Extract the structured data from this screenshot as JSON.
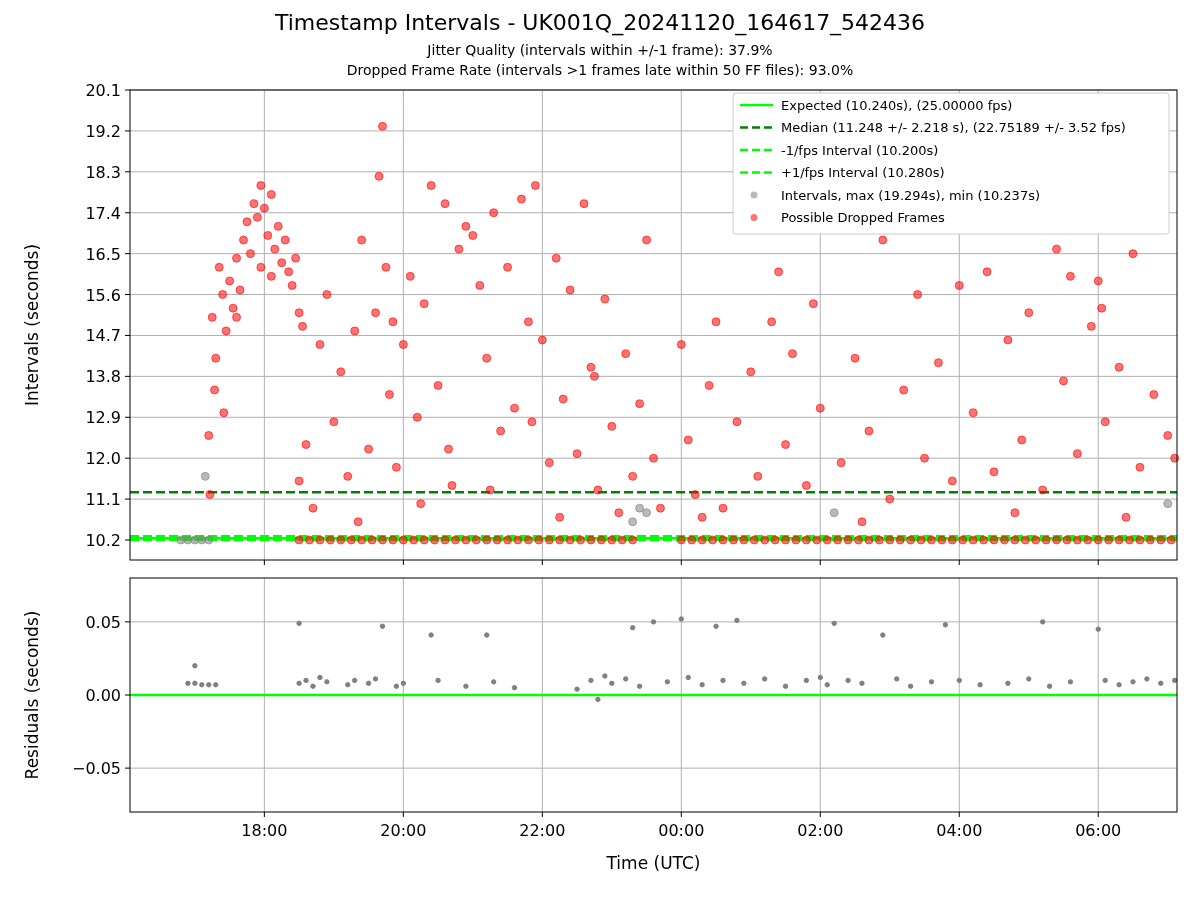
{
  "title": "Timestamp Intervals - UK001Q_20241120_164617_542436",
  "subtitles": [
    "Jitter Quality (intervals within +/-1 frame): 37.9%",
    "Dropped Frame Rate (intervals >1 frames late within 50 FF files): 93.0%"
  ],
  "interval_plot": {
    "chart_data": {
      "type": "scatter",
      "ylabel": "Intervals (seconds)",
      "grid": true,
      "legend": true,
      "xlim": [
        "2024-11-20T16:04",
        "2024-11-21T07:08"
      ],
      "ylim": [
        9.76,
        20.1
      ],
      "yticks": [
        {
          "value": 10.2,
          "label": "10.2"
        },
        {
          "value": 11.1,
          "label": "11.1"
        },
        {
          "value": 12.0,
          "label": "12.0"
        },
        {
          "value": 12.9,
          "label": "12.9"
        },
        {
          "value": 13.8,
          "label": "13.8"
        },
        {
          "value": 14.7,
          "label": "14.7"
        },
        {
          "value": 15.6,
          "label": "15.6"
        },
        {
          "value": 16.5,
          "label": "16.5"
        },
        {
          "value": 17.4,
          "label": "17.4"
        },
        {
          "value": 18.3,
          "label": "18.3"
        },
        {
          "value": 19.2,
          "label": "19.2"
        },
        {
          "value": 20.1,
          "label": "20.1"
        }
      ],
      "ref_lines": [
        {
          "label": "Expected (10.240s), (25.00000 fps)",
          "axis": "y",
          "value": 10.24,
          "color": "#00ff00"
        },
        {
          "label": "Median (11.248 +/- 2.218 s), (22.75189 +/- 3.52 fps)",
          "axis": "y",
          "value": 11.248,
          "color": "#008000"
        },
        {
          "label": "-1/fps Interval (10.200s)",
          "axis": "y",
          "value": 10.2,
          "color": "#00ff00"
        },
        {
          "label": "+1/fps Interval (10.280s)",
          "axis": "y",
          "value": 10.28,
          "color": "#00ff00"
        }
      ],
      "series": [
        {
          "name": "Intervals, max (19.294s), min (10.237s)",
          "color": "#808080",
          "x": [
            "2024-11-20T16:48",
            "2024-11-20T16:54",
            "2024-11-20T17:00",
            "2024-11-20T17:06",
            "2024-11-20T17:12",
            "2024-11-20T17:09",
            "2024-11-20T23:18",
            "2024-11-20T23:24",
            "2024-11-20T23:30",
            "2024-11-21T02:12",
            "2024-11-21T07:00"
          ],
          "values": [
            10.2,
            10.2,
            10.2,
            10.2,
            10.2,
            11.6,
            10.6,
            10.9,
            10.8,
            10.8,
            11.0
          ]
        },
        {
          "name": "Possible Dropped Frames",
          "color": "#ff0000",
          "x": [
            "2024-11-20T17:12",
            "2024-11-20T17:15",
            "2024-11-20T17:18",
            "2024-11-20T17:21",
            "2024-11-20T17:24",
            "2024-11-20T17:27",
            "2024-11-20T17:30",
            "2024-11-20T17:33",
            "2024-11-20T17:36",
            "2024-11-20T17:39",
            "2024-11-20T17:42",
            "2024-11-20T17:45",
            "2024-11-20T17:48",
            "2024-11-20T17:51",
            "2024-11-20T17:54",
            "2024-11-20T17:57",
            "2024-11-20T18:00",
            "2024-11-20T18:03",
            "2024-11-20T18:06",
            "2024-11-20T18:09",
            "2024-11-20T18:12",
            "2024-11-20T18:15",
            "2024-11-20T18:18",
            "2024-11-20T18:21",
            "2024-11-20T18:24",
            "2024-11-20T18:27",
            "2024-11-20T18:30",
            "2024-11-20T18:33",
            "2024-11-20T17:13",
            "2024-11-20T17:17",
            "2024-11-20T17:25",
            "2024-11-20T17:57",
            "2024-11-20T18:06",
            "2024-11-20T17:36",
            "2024-11-20T18:30",
            "2024-11-20T18:36",
            "2024-11-20T18:42",
            "2024-11-20T18:48",
            "2024-11-20T18:54",
            "2024-11-20T19:00",
            "2024-11-20T19:06",
            "2024-11-20T19:12",
            "2024-11-20T19:18",
            "2024-11-20T19:24",
            "2024-11-20T19:30",
            "2024-11-20T19:36",
            "2024-11-20T19:39",
            "2024-11-20T19:42",
            "2024-11-20T19:45",
            "2024-11-20T19:48",
            "2024-11-20T19:54",
            "2024-11-20T20:00",
            "2024-11-20T20:06",
            "2024-11-20T20:12",
            "2024-11-20T20:18",
            "2024-11-20T20:24",
            "2024-11-20T20:30",
            "2024-11-20T20:36",
            "2024-11-20T20:42",
            "2024-11-20T20:48",
            "2024-11-20T20:54",
            "2024-11-20T21:00",
            "2024-11-20T21:06",
            "2024-11-20T21:12",
            "2024-11-20T21:18",
            "2024-11-20T21:24",
            "2024-11-20T21:30",
            "2024-11-20T21:36",
            "2024-11-20T21:42",
            "2024-11-20T21:48",
            "2024-11-20T21:54",
            "2024-11-20T22:00",
            "2024-11-20T22:06",
            "2024-11-20T22:12",
            "2024-11-20T22:18",
            "2024-11-20T22:24",
            "2024-11-20T22:30",
            "2024-11-20T22:36",
            "2024-11-20T22:42",
            "2024-11-20T22:48",
            "2024-11-20T22:54",
            "2024-11-20T23:00",
            "2024-11-20T23:06",
            "2024-11-20T23:12",
            "2024-11-20T23:18",
            "2024-11-20T23:24",
            "2024-11-20T23:30",
            "2024-11-20T23:36",
            "2024-11-20T23:42",
            "2024-11-20T19:21",
            "2024-11-20T20:15",
            "2024-11-20T21:15",
            "2024-11-20T22:15",
            "2024-11-20T20:39",
            "2024-11-20T21:51",
            "2024-11-20T19:51",
            "2024-11-20T22:45",
            "2024-11-21T00:00",
            "2024-11-21T00:06",
            "2024-11-21T00:12",
            "2024-11-21T00:24",
            "2024-11-21T00:30",
            "2024-11-21T00:36",
            "2024-11-21T00:48",
            "2024-11-21T01:00",
            "2024-11-21T01:06",
            "2024-11-21T01:18",
            "2024-11-21T01:30",
            "2024-11-21T01:36",
            "2024-11-21T01:48",
            "2024-11-21T01:54",
            "2024-11-21T02:00",
            "2024-11-21T02:18",
            "2024-11-21T02:30",
            "2024-11-21T02:42",
            "2024-11-21T02:54",
            "2024-11-21T03:00",
            "2024-11-21T03:12",
            "2024-11-21T03:24",
            "2024-11-21T03:30",
            "2024-11-21T03:42",
            "2024-11-21T03:54",
            "2024-11-21T04:00",
            "2024-11-21T04:12",
            "2024-11-21T04:24",
            "2024-11-21T04:30",
            "2024-11-21T04:42",
            "2024-11-21T04:54",
            "2024-11-21T05:00",
            "2024-11-21T05:12",
            "2024-11-21T05:24",
            "2024-11-21T05:30",
            "2024-11-21T05:42",
            "2024-11-21T05:54",
            "2024-11-21T06:00",
            "2024-11-21T06:03",
            "2024-11-21T06:06",
            "2024-11-21T06:18",
            "2024-11-21T06:30",
            "2024-11-21T06:36",
            "2024-11-21T06:48",
            "2024-11-21T07:00",
            "2024-11-21T07:06",
            "2024-11-21T05:36",
            "2024-11-21T01:24",
            "2024-11-21T00:18",
            "2024-11-21T02:36",
            "2024-11-21T04:48",
            "2024-11-21T06:24",
            "2024-11-20T18:30",
            "2024-11-20T18:39",
            "2024-11-20T18:48",
            "2024-11-20T18:57",
            "2024-11-20T19:06",
            "2024-11-20T19:15",
            "2024-11-20T19:24",
            "2024-11-20T19:33",
            "2024-11-20T19:42",
            "2024-11-20T19:51",
            "2024-11-20T20:00",
            "2024-11-20T20:09",
            "2024-11-20T20:18",
            "2024-11-20T20:27",
            "2024-11-20T20:36",
            "2024-11-20T20:45",
            "2024-11-20T20:54",
            "2024-11-20T21:03",
            "2024-11-20T21:12",
            "2024-11-20T21:21",
            "2024-11-20T21:30",
            "2024-11-20T21:39",
            "2024-11-20T21:48",
            "2024-11-20T21:57",
            "2024-11-20T22:06",
            "2024-11-20T22:15",
            "2024-11-20T22:24",
            "2024-11-20T22:33",
            "2024-11-20T22:42",
            "2024-11-20T22:51",
            "2024-11-20T23:00",
            "2024-11-20T23:09",
            "2024-11-20T23:18",
            "2024-11-21T00:00",
            "2024-11-21T00:09",
            "2024-11-21T00:18",
            "2024-11-21T00:27",
            "2024-11-21T00:36",
            "2024-11-21T00:45",
            "2024-11-21T00:54",
            "2024-11-21T01:03",
            "2024-11-21T01:12",
            "2024-11-21T01:21",
            "2024-11-21T01:30",
            "2024-11-21T01:39",
            "2024-11-21T01:48",
            "2024-11-21T01:57",
            "2024-11-21T02:06",
            "2024-11-21T02:15",
            "2024-11-21T02:24",
            "2024-11-21T02:33",
            "2024-11-21T02:42",
            "2024-11-21T02:51",
            "2024-11-21T03:00",
            "2024-11-21T03:09",
            "2024-11-21T03:18",
            "2024-11-21T03:27",
            "2024-11-21T03:36",
            "2024-11-21T03:45",
            "2024-11-21T03:54",
            "2024-11-21T04:03",
            "2024-11-21T04:12",
            "2024-11-21T04:21",
            "2024-11-21T04:30",
            "2024-11-21T04:39",
            "2024-11-21T04:48",
            "2024-11-21T04:57",
            "2024-11-21T05:06",
            "2024-11-21T05:15",
            "2024-11-21T05:24",
            "2024-11-21T05:33",
            "2024-11-21T05:42",
            "2024-11-21T05:51",
            "2024-11-21T06:00",
            "2024-11-21T06:09",
            "2024-11-21T06:18",
            "2024-11-21T06:27",
            "2024-11-21T06:36",
            "2024-11-21T06:45",
            "2024-11-21T06:54",
            "2024-11-21T07:03"
          ],
          "values": [
            12.5,
            15.1,
            14.2,
            16.2,
            15.6,
            14.8,
            15.9,
            15.3,
            16.4,
            15.7,
            16.8,
            17.2,
            16.5,
            17.6,
            17.3,
            18.0,
            17.5,
            16.9,
            17.8,
            16.6,
            17.1,
            16.3,
            16.8,
            16.1,
            15.8,
            16.4,
            15.2,
            14.9,
            11.2,
            13.5,
            13.0,
            16.2,
            16.0,
            15.1,
            11.5,
            12.3,
            10.9,
            14.5,
            15.6,
            12.8,
            13.9,
            11.6,
            14.8,
            16.8,
            12.2,
            15.2,
            18.2,
            19.3,
            16.2,
            13.4,
            11.8,
            14.5,
            16.0,
            12.9,
            15.4,
            18.0,
            13.6,
            17.6,
            11.4,
            16.6,
            17.1,
            16.9,
            15.8,
            14.2,
            17.4,
            12.6,
            16.2,
            13.1,
            17.7,
            15.0,
            18.0,
            14.6,
            11.9,
            16.4,
            13.3,
            15.7,
            12.1,
            17.6,
            14.0,
            11.3,
            15.5,
            12.7,
            10.8,
            14.3,
            11.6,
            13.2,
            16.8,
            12.0,
            10.9,
            10.6,
            11.0,
            11.3,
            10.7,
            12.2,
            12.8,
            15.0,
            13.8,
            14.5,
            12.4,
            11.2,
            13.6,
            15.0,
            10.9,
            12.8,
            13.9,
            11.6,
            15.0,
            12.3,
            14.3,
            11.4,
            15.4,
            13.1,
            11.9,
            14.2,
            12.6,
            16.8,
            11.1,
            13.5,
            15.6,
            12.0,
            14.1,
            11.5,
            15.8,
            13.0,
            16.1,
            11.7,
            14.6,
            12.4,
            15.2,
            11.3,
            16.6,
            13.7,
            12.1,
            14.9,
            15.9,
            15.3,
            12.8,
            14.0,
            16.5,
            11.8,
            13.4,
            12.5,
            12.0,
            16.0,
            16.1,
            10.7,
            10.6,
            10.8,
            10.7,
            10.2,
            10.2,
            10.2,
            10.2,
            10.2,
            10.2,
            10.2,
            10.2,
            10.2,
            10.2,
            10.2,
            10.2,
            10.2,
            10.2,
            10.2,
            10.2,
            10.2,
            10.2,
            10.2,
            10.2,
            10.2,
            10.2,
            10.2,
            10.2,
            10.2,
            10.2,
            10.2,
            10.2,
            10.2,
            10.2,
            10.2,
            10.2,
            10.2,
            10.2,
            10.2,
            10.2,
            10.2,
            10.2,
            10.2,
            10.2,
            10.2,
            10.2,
            10.2,
            10.2,
            10.2,
            10.2,
            10.2,
            10.2,
            10.2,
            10.2,
            10.2,
            10.2,
            10.2,
            10.2,
            10.2,
            10.2,
            10.2,
            10.2,
            10.2,
            10.2,
            10.2,
            10.2,
            10.2,
            10.2,
            10.2,
            10.2,
            10.2,
            10.2,
            10.2,
            10.2,
            10.2,
            10.2,
            10.2,
            10.2,
            10.2,
            10.2,
            10.2,
            10.2,
            10.2,
            10.2,
            10.2
          ]
        }
      ]
    }
  },
  "residual_plot": {
    "chart_data": {
      "type": "scatter",
      "xlabel": "Time (UTC)",
      "ylabel": "Residuals (seconds)",
      "grid": true,
      "xlim": [
        "2024-11-20T16:04",
        "2024-11-21T07:08"
      ],
      "ylim": [
        -0.08,
        0.08
      ],
      "xticks": [
        {
          "value": "2024-11-20T18:00",
          "label": "18:00"
        },
        {
          "value": "2024-11-20T20:00",
          "label": "20:00"
        },
        {
          "value": "2024-11-20T22:00",
          "label": "22:00"
        },
        {
          "value": "2024-11-21T00:00",
          "label": "00:00"
        },
        {
          "value": "2024-11-21T02:00",
          "label": "02:00"
        },
        {
          "value": "2024-11-21T04:00",
          "label": "04:00"
        },
        {
          "value": "2024-11-21T06:00",
          "label": "06:00"
        }
      ],
      "yticks": [
        {
          "value": 0.05,
          "label": "0.05"
        },
        {
          "value": 0,
          "label": "0.00"
        },
        {
          "value": -0.05,
          "label": "−0.05"
        }
      ],
      "ref_lines": [
        {
          "axis": "y",
          "value": 0,
          "color": "#00ff00"
        }
      ],
      "series": [
        {
          "color": "#808080",
          "x": [
            "2024-11-20T17:00",
            "2024-11-20T16:54",
            "2024-11-20T17:00",
            "2024-11-20T17:06",
            "2024-11-20T17:12",
            "2024-11-20T17:18",
            "2024-11-20T18:30",
            "2024-11-20T18:30",
            "2024-11-20T18:36",
            "2024-11-20T18:42",
            "2024-11-20T18:48",
            "2024-11-20T18:54",
            "2024-11-20T19:12",
            "2024-11-20T19:18",
            "2024-11-20T19:30",
            "2024-11-20T19:36",
            "2024-11-20T19:42",
            "2024-11-20T19:54",
            "2024-11-20T20:00",
            "2024-11-20T20:24",
            "2024-11-20T20:30",
            "2024-11-20T20:54",
            "2024-11-20T21:12",
            "2024-11-20T21:18",
            "2024-11-20T21:36",
            "2024-11-20T22:30",
            "2024-11-20T22:42",
            "2024-11-20T22:48",
            "2024-11-20T22:54",
            "2024-11-20T23:00",
            "2024-11-20T23:12",
            "2024-11-20T23:18",
            "2024-11-20T23:24",
            "2024-11-20T23:36",
            "2024-11-20T23:48",
            "2024-11-21T00:00",
            "2024-11-21T00:06",
            "2024-11-21T00:18",
            "2024-11-21T00:30",
            "2024-11-21T00:36",
            "2024-11-21T00:48",
            "2024-11-21T00:54",
            "2024-11-21T01:12",
            "2024-11-21T01:30",
            "2024-11-21T01:48",
            "2024-11-21T02:00",
            "2024-11-21T02:06",
            "2024-11-21T02:12",
            "2024-11-21T02:24",
            "2024-11-21T02:36",
            "2024-11-21T02:54",
            "2024-11-21T03:06",
            "2024-11-21T03:18",
            "2024-11-21T03:36",
            "2024-11-21T03:48",
            "2024-11-21T04:00",
            "2024-11-21T04:18",
            "2024-11-21T04:42",
            "2024-11-21T05:00",
            "2024-11-21T05:12",
            "2024-11-21T05:18",
            "2024-11-21T05:36",
            "2024-11-21T06:00",
            "2024-11-21T06:06",
            "2024-11-21T06:18",
            "2024-11-21T06:30",
            "2024-11-21T06:42",
            "2024-11-21T06:54",
            "2024-11-21T07:06"
          ],
          "values": [
            0.02,
            0.008,
            0.008,
            0.007,
            0.007,
            0.007,
            0.049,
            0.008,
            0.01,
            0.006,
            0.012,
            0.009,
            0.007,
            0.01,
            0.008,
            0.011,
            0.047,
            0.006,
            0.008,
            0.041,
            0.01,
            0.006,
            0.041,
            0.009,
            0.005,
            0.004,
            0.01,
            -0.003,
            0.013,
            0.008,
            0.011,
            0.046,
            0.006,
            0.05,
            0.009,
            0.052,
            0.012,
            0.007,
            0.047,
            0.01,
            0.051,
            0.008,
            0.011,
            0.006,
            0.01,
            0.012,
            0.007,
            0.049,
            0.01,
            0.008,
            0.041,
            0.011,
            0.006,
            0.009,
            0.048,
            0.01,
            0.007,
            0.008,
            0.011,
            0.05,
            0.006,
            0.009,
            0.045,
            0.01,
            0.007,
            0.009,
            0.011,
            0.008,
            0.01
          ]
        }
      ]
    }
  }
}
